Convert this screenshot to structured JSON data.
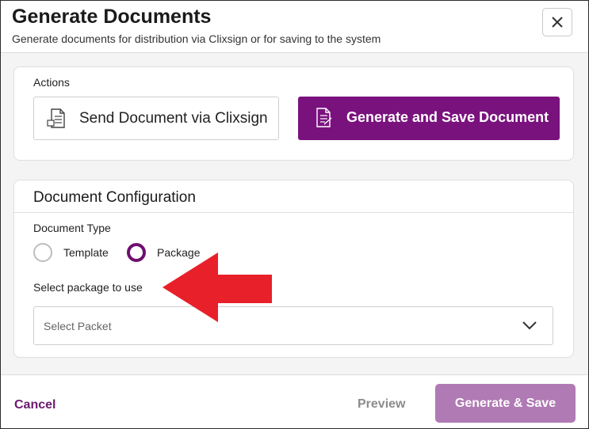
{
  "header": {
    "title": "Generate Documents",
    "subtitle": "Generate documents for distribution via Clixsign or for saving to the system",
    "close_icon": "close-icon"
  },
  "actions": {
    "label": "Actions",
    "send_button": {
      "label": "Send Document via Clixsign",
      "icon": "document-icon"
    },
    "generate_button": {
      "label": "Generate and Save Document",
      "icon": "document-icon"
    }
  },
  "config": {
    "title": "Document Configuration",
    "document_type_label": "Document Type",
    "radio_template": "Template",
    "radio_package": "Package",
    "selected_type": "Package",
    "select_label": "Select package to use",
    "select_placeholder": "Select Packet"
  },
  "footer": {
    "cancel": "Cancel",
    "preview": "Preview",
    "generate_save": "Generate & Save"
  },
  "colors": {
    "accent": "#7a127e",
    "accent_disabled": "#b07ab4",
    "arrow": "#e8202a"
  }
}
